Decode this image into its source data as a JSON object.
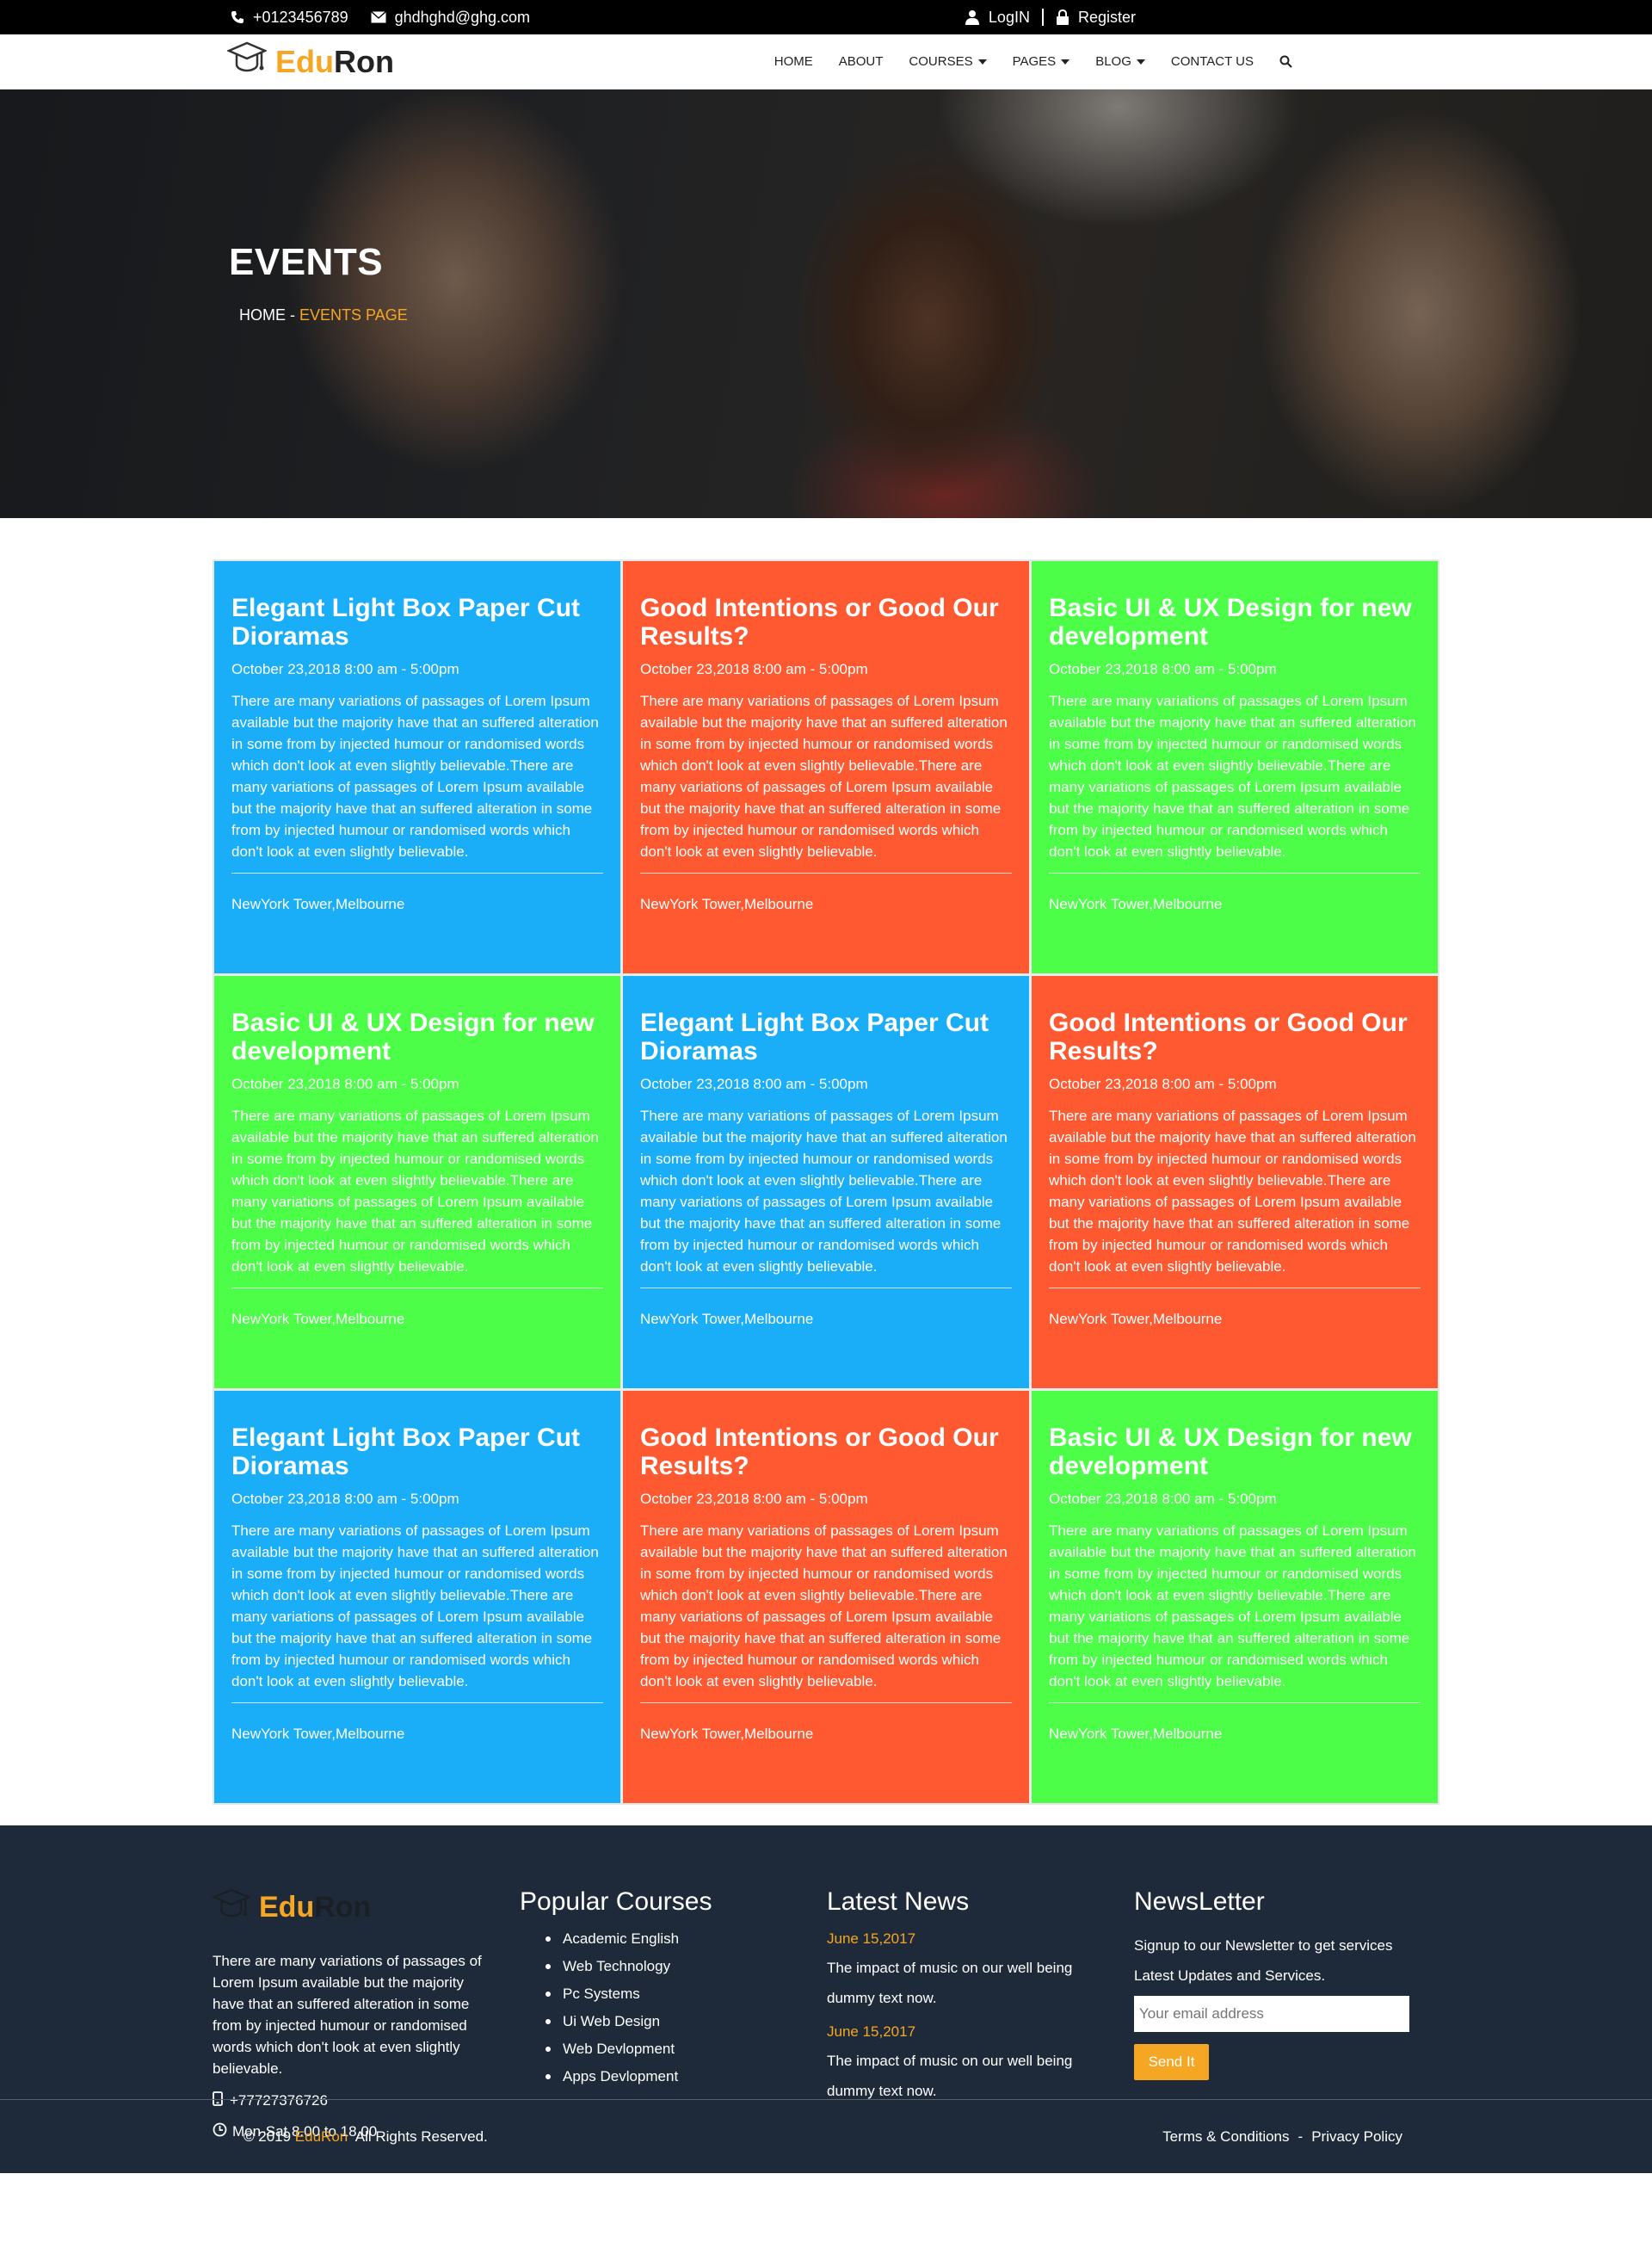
{
  "topbar": {
    "phone": "+0123456789",
    "email": "ghdhghd@ghg.com",
    "login": "LogIN",
    "register": "Register"
  },
  "brand": {
    "part1": "Edu",
    "part2": "Ron"
  },
  "nav": {
    "home": "HOME",
    "about": "ABOUT",
    "courses": "COURSES",
    "pages": "PAGES",
    "blog": "BLOG",
    "contact": "CONTACT US"
  },
  "hero": {
    "title": "EVENTS",
    "breadcrumb_home": "HOME",
    "breadcrumb_sep": " - ",
    "breadcrumb_current": "EVENTS PAGE"
  },
  "events": [
    {
      "title": "Elegant Light Box Paper Cut Dioramas",
      "date": "October 23,2018 8:00 am - 5:00pm",
      "desc": "There are many variations of passages of Lorem Ipsum available but the majority have that an suffered alteration in some from by injected humour or randomised words which don't look at even slightly believable.There are many variations of passages of Lorem Ipsum available but the majority have that an suffered alteration in some from by injected humour or randomised words which don't look at even slightly believable.",
      "location": "NewYork Tower,Melbourne",
      "color": "#19aef7"
    },
    {
      "title": "Good Intentions or Good Our Results?",
      "date": "October 23,2018 8:00 am - 5:00pm",
      "desc": "There are many variations of passages of Lorem Ipsum available but the majority have that an suffered alteration in some from by injected humour or randomised words which don't look at even slightly believable.There are many variations of passages of Lorem Ipsum available but the majority have that an suffered alteration in some from by injected humour or randomised words which don't look at even slightly believable.",
      "location": "NewYork Tower,Melbourne",
      "color": "#fe5931"
    },
    {
      "title": "Basic UI & UX Design for new development",
      "date": "October 23,2018 8:00 am - 5:00pm",
      "desc": "There are many variations of passages of Lorem Ipsum available but the majority have that an suffered alteration in some from by injected humour or randomised words which don't look at even slightly believable.There are many variations of passages of Lorem Ipsum available but the majority have that an suffered alteration in some from by injected humour or randomised words which don't look at even slightly believable.",
      "location": "NewYork Tower,Melbourne",
      "color": "#4cfe48"
    },
    {
      "title": "Basic UI & UX Design for new development",
      "date": "October 23,2018 8:00 am - 5:00pm",
      "desc": "There are many variations of passages of Lorem Ipsum available but the majority have that an suffered alteration in some from by injected humour or randomised words which don't look at even slightly believable.There are many variations of passages of Lorem Ipsum available but the majority have that an suffered alteration in some from by injected humour or randomised words which don't look at even slightly believable.",
      "location": "NewYork Tower,Melbourne",
      "color": "#4cfe48"
    },
    {
      "title": "Elegant Light Box Paper Cut Dioramas",
      "date": "October 23,2018 8:00 am - 5:00pm",
      "desc": "There are many variations of passages of Lorem Ipsum available but the majority have that an suffered alteration in some from by injected humour or randomised words which don't look at even slightly believable.There are many variations of passages of Lorem Ipsum available but the majority have that an suffered alteration in some from by injected humour or randomised words which don't look at even slightly believable.",
      "location": "NewYork Tower,Melbourne",
      "color": "#19aef7"
    },
    {
      "title": "Good Intentions or Good Our Results?",
      "date": "October 23,2018 8:00 am - 5:00pm",
      "desc": "There are many variations of passages of Lorem Ipsum available but the majority have that an suffered alteration in some from by injected humour or randomised words which don't look at even slightly believable.There are many variations of passages of Lorem Ipsum available but the majority have that an suffered alteration in some from by injected humour or randomised words which don't look at even slightly believable.",
      "location": "NewYork Tower,Melbourne",
      "color": "#fe5931"
    },
    {
      "title": "Elegant Light Box Paper Cut Dioramas",
      "date": "October 23,2018 8:00 am - 5:00pm",
      "desc": "There are many variations of passages of Lorem Ipsum available but the majority have that an suffered alteration in some from by injected humour or randomised words which don't look at even slightly believable.There are many variations of passages of Lorem Ipsum available but the majority have that an suffered alteration in some from by injected humour or randomised words which don't look at even slightly believable.",
      "location": "NewYork Tower,Melbourne",
      "color": "#19aef7"
    },
    {
      "title": "Good Intentions or Good Our Results?",
      "date": "October 23,2018 8:00 am - 5:00pm",
      "desc": "There are many variations of passages of Lorem Ipsum available but the majority have that an suffered alteration in some from by injected humour or randomised words which don't look at even slightly believable.There are many variations of passages of Lorem Ipsum available but the majority have that an suffered alteration in some from by injected humour or randomised words which don't look at even slightly believable.",
      "location": "NewYork Tower,Melbourne",
      "color": "#fe5931"
    },
    {
      "title": "Basic UI & UX Design for new development",
      "date": "October 23,2018 8:00 am - 5:00pm",
      "desc": "There are many variations of passages of Lorem Ipsum available but the majority have that an suffered alteration in some from by injected humour or randomised words which don't look at even slightly believable.There are many variations of passages of Lorem Ipsum available but the majority have that an suffered alteration in some from by injected humour or randomised words which don't look at even slightly believable.",
      "location": "NewYork Tower,Melbourne",
      "color": "#4cfe48"
    }
  ],
  "footer": {
    "about": "There are many variations of passages of Lorem Ipsum available but the majority have that an suffered alteration in some from by injected humour or randomised words which don't look at even slightly believable.",
    "phone": "+77727376726",
    "hours": "Mon-Sat 8.00 to 18.00",
    "courses_heading": "Popular Courses",
    "courses": [
      "Academic English",
      "Web Technology",
      "Pc Systems",
      "Ui Web Design",
      "Web Devlopment",
      "Apps Devlopment"
    ],
    "news_heading": "Latest News",
    "news": [
      {
        "date": "June 15,2017",
        "text": "The impact of music on our well being dummy text now."
      },
      {
        "date": "June 15,2017",
        "text": "The impact of music on our well being dummy text now."
      }
    ],
    "newsletter_heading": "NewsLetter",
    "newsletter_text": "Signup to our Newsletter to get services Latest Updates and Services.",
    "email_placeholder": "Your email address",
    "send_label": "Send It",
    "copyright_prefix": "© 2019 ",
    "copyright_brand": "EduRon",
    "copyright_suffix": "  All Rights Reserved.",
    "terms": "Terms & Conditions",
    "link_sep": "-",
    "privacy": "Privacy Policy"
  },
  "colors": {
    "accent": "#f5a623",
    "blue_card": "#19aef7",
    "red_card": "#fe5931",
    "green_card": "#4cfe48",
    "footer_bg": "#1e2a3a"
  },
  "icons": [
    "phone-icon",
    "envelope-icon",
    "user-icon",
    "lock-icon",
    "graduation-cap-icon",
    "search-icon",
    "mobile-icon",
    "clock-icon"
  ]
}
